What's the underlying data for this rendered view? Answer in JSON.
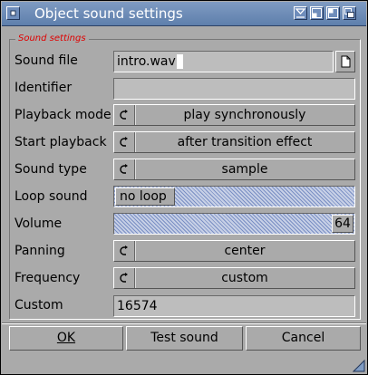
{
  "window": {
    "title": "Object sound settings"
  },
  "group": {
    "title": "Sound settings"
  },
  "fields": {
    "sound_file": {
      "label": "Sound file",
      "value": "intro.wav"
    },
    "identifier": {
      "label": "Identifier",
      "value": ""
    },
    "playback_mode": {
      "label": "Playback mode",
      "value": "play synchronously"
    },
    "start_playback": {
      "label": "Start playback",
      "value": "after transition effect"
    },
    "sound_type": {
      "label": "Sound type",
      "value": "sample"
    },
    "loop_sound": {
      "label": "Loop sound",
      "value": "no loop",
      "level": 0
    },
    "volume": {
      "label": "Volume",
      "value": "64",
      "max": 64
    },
    "panning": {
      "label": "Panning",
      "value": "center"
    },
    "frequency": {
      "label": "Frequency",
      "value": "custom"
    },
    "custom": {
      "label": "Custom",
      "value": "16574"
    }
  },
  "buttons": {
    "ok": "OK",
    "test": "Test sound",
    "cancel": "Cancel"
  },
  "icons": {
    "close": "close-icon",
    "zoom": "zoom-icon",
    "iconify": "iconify-icon",
    "depth": "depth-icon",
    "file": "file-requester-icon",
    "cycle": "cycle-icon",
    "resize": "resize-grip-icon"
  }
}
